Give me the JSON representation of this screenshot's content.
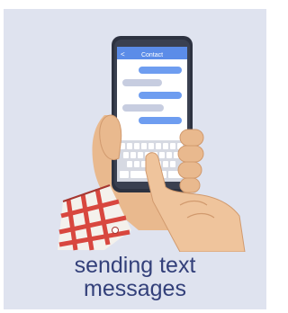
{
  "caption": {
    "line1": "sending text",
    "line2": "messages"
  },
  "phone": {
    "header_title": "Contact",
    "back_glyph": "<"
  },
  "colors": {
    "card_background": "#dfe3ef",
    "caption_text": "#33407a",
    "phone_body": "#2d3240",
    "screen_header": "#5b8ce8",
    "sent_bubble": "#6e9df0",
    "received_bubble": "#c7cde0",
    "skin": "#e9b98e",
    "sleeve_plaid": "#d8473f"
  },
  "icons": {
    "phone": "smartphone-icon",
    "hands": "hands-holding-phone-illustration"
  }
}
